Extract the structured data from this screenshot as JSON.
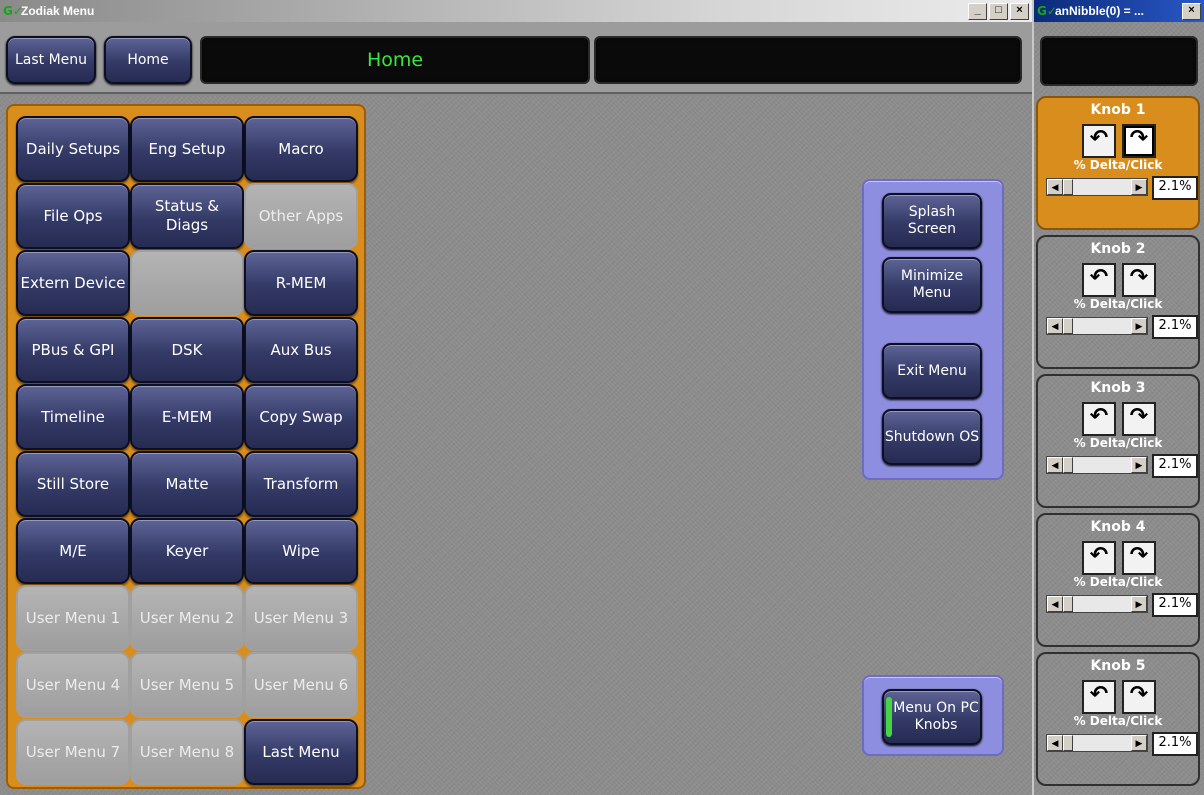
{
  "main_window": {
    "title": "Zodiak Menu",
    "btn_min": "_",
    "btn_max": "□",
    "btn_close": "×"
  },
  "top": {
    "last_menu": "Last Menu",
    "home": "Home",
    "lcd1": "Home",
    "lcd2": ""
  },
  "grid": [
    [
      "Daily Setups",
      "Eng Setup",
      "Macro"
    ],
    [
      "File Ops",
      "Status & Diags",
      "Other Apps"
    ],
    [
      "Extern Device",
      "",
      "R-MEM"
    ],
    [
      "PBus & GPI",
      "DSK",
      "Aux Bus"
    ],
    [
      "Timeline",
      "E-MEM",
      "Copy Swap"
    ],
    [
      "Still Store",
      "Matte",
      "Transform"
    ],
    [
      "M/E",
      "Keyer",
      "Wipe"
    ],
    [
      "User Menu 1",
      "User Menu 2",
      "User Menu 3"
    ],
    [
      "User Menu 4",
      "User Menu 5",
      "User Menu 6"
    ],
    [
      "User Menu 7",
      "User Menu 8",
      "Last Menu"
    ]
  ],
  "right_panel": {
    "splash": "Splash Screen",
    "minimize": "Minimize Menu",
    "exit": "Exit Menu",
    "shutdown": "Shutdown OS"
  },
  "pc_knobs": {
    "label": "Menu On PC Knobs",
    "indicator_color": "#44d444"
  },
  "knob_window": {
    "title": "anNibble(0) = ..."
  },
  "knobs": [
    {
      "title": "Knob 1",
      "delta_label": "% Delta/Click",
      "value": "2.1%",
      "active": true
    },
    {
      "title": "Knob 2",
      "delta_label": "% Delta/Click",
      "value": "2.1%",
      "active": false
    },
    {
      "title": "Knob 3",
      "delta_label": "% Delta/Click",
      "value": "2.1%",
      "active": false
    },
    {
      "title": "Knob 4",
      "delta_label": "% Delta/Click",
      "value": "2.1%",
      "active": false
    },
    {
      "title": "Knob 5",
      "delta_label": "% Delta/Click",
      "value": "2.1%",
      "active": false
    }
  ],
  "colors": {
    "accent_orange": "#d98d1c",
    "lcd_green": "#39e83a",
    "panel_purple": "#8e8ee0",
    "button_navy": "#343a66"
  },
  "icons": {
    "rotate_ccw": "↶",
    "rotate_cw": "↷",
    "arrow_left": "◀",
    "arrow_right": "▶",
    "app_logo": "G✓"
  }
}
